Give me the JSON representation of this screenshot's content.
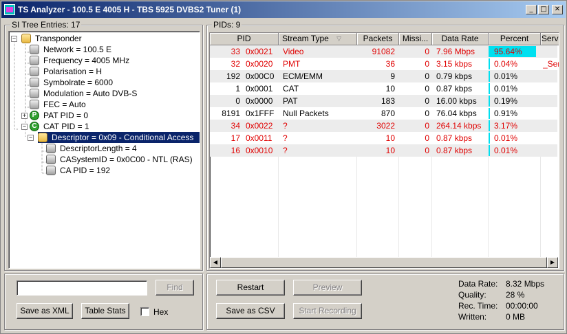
{
  "window": {
    "title": "TS Analyzer - 100.5 E 4005 H - TBS 5925 DVBS2 Tuner (1)"
  },
  "left_panel": {
    "label": "SI Tree Entries: 17",
    "tree": [
      {
        "text": "Transponder",
        "icon": "folder-icon",
        "expander": "−"
      },
      {
        "text": "Network = 100.5 E",
        "icon": "gray-node-icon"
      },
      {
        "text": "Frequency = 4005 MHz",
        "icon": "gray-node-icon"
      },
      {
        "text": "Polarisation = H",
        "icon": "gray-node-icon"
      },
      {
        "text": "Symbolrate = 6000",
        "icon": "gray-node-icon"
      },
      {
        "text": "Modulation = Auto DVB-S",
        "icon": "gray-node-icon"
      },
      {
        "text": "FEC = Auto",
        "icon": "gray-node-icon"
      },
      {
        "text": "PAT PID = 0",
        "icon": "pat-icon",
        "badge": "P",
        "expander": "+"
      },
      {
        "text": "CAT PID = 1",
        "icon": "cat-icon",
        "badge": "C",
        "expander": "−"
      },
      {
        "text": "Descriptor = 0x09 - Conditional Access",
        "icon": "folder-icon",
        "expander": "−",
        "selected": true
      },
      {
        "text": "DescriptorLength = 4",
        "icon": "gray-node-icon"
      },
      {
        "text": "CASystemID = 0x0C00 - NTL (RAS)",
        "icon": "gray-node-icon"
      },
      {
        "text": "CA PID = 192",
        "icon": "gray-node-icon"
      }
    ],
    "search_value": "",
    "find_label": "Find",
    "save_xml_label": "Save as XML",
    "table_stats_label": "Table Stats",
    "hex_label": "Hex"
  },
  "right_panel": {
    "label": "PIDs: 9",
    "columns": [
      "PID",
      "Stream Type",
      "Packets",
      "Missi...",
      "Data Rate",
      "Percent",
      "Servi"
    ],
    "rows": [
      {
        "pid": "33",
        "hex": "0x0021",
        "type": "Video",
        "packets": "91082",
        "missing": "0",
        "rate": "7.96 Mbps",
        "percent": "95.64%",
        "pct": 0.9564,
        "service": "",
        "red": true
      },
      {
        "pid": "32",
        "hex": "0x0020",
        "type": "PMT",
        "packets": "36",
        "missing": "0",
        "rate": "3.15 kbps",
        "percent": "0.04%",
        "pct": 0.0004,
        "service": "_Serv",
        "red": true
      },
      {
        "pid": "192",
        "hex": "0x00C0",
        "type": "ECM/EMM",
        "packets": "9",
        "missing": "0",
        "rate": "0.79 kbps",
        "percent": "0.01%",
        "pct": 0.0001,
        "service": "",
        "red": false
      },
      {
        "pid": "1",
        "hex": "0x0001",
        "type": "CAT",
        "packets": "10",
        "missing": "0",
        "rate": "0.87 kbps",
        "percent": "0.01%",
        "pct": 0.0001,
        "service": "",
        "red": false
      },
      {
        "pid": "0",
        "hex": "0x0000",
        "type": "PAT",
        "packets": "183",
        "missing": "0",
        "rate": "16.00 kbps",
        "percent": "0.19%",
        "pct": 0.0019,
        "service": "",
        "red": false
      },
      {
        "pid": "8191",
        "hex": "0x1FFF",
        "type": "Null Packets",
        "packets": "870",
        "missing": "0",
        "rate": "76.04 kbps",
        "percent": "0.91%",
        "pct": 0.0091,
        "service": "",
        "red": false
      },
      {
        "pid": "34",
        "hex": "0x0022",
        "type": "?",
        "packets": "3022",
        "missing": "0",
        "rate": "264.14 kbps",
        "percent": "3.17%",
        "pct": 0.0317,
        "service": "",
        "red": true
      },
      {
        "pid": "17",
        "hex": "0x0011",
        "type": "?",
        "packets": "10",
        "missing": "0",
        "rate": "0.87 kbps",
        "percent": "0.01%",
        "pct": 0.0001,
        "service": "",
        "red": true
      },
      {
        "pid": "16",
        "hex": "0x0010",
        "type": "?",
        "packets": "10",
        "missing": "0",
        "rate": "0.87 kbps",
        "percent": "0.01%",
        "pct": 0.0001,
        "service": "",
        "red": true
      }
    ],
    "restart_label": "Restart",
    "preview_label": "Preview",
    "save_csv_label": "Save as CSV",
    "start_recording_label": "Start Recording",
    "stats": [
      {
        "label": "Data Rate:",
        "value": "8.32 Mbps"
      },
      {
        "label": "Quality:",
        "value": "28 %"
      },
      {
        "label": "Rec. Time:",
        "value": "00:00:00"
      },
      {
        "label": "Written:",
        "value": "0 MB"
      }
    ]
  },
  "colors": {
    "accent_red": "#e00000",
    "percent_bar": "#00e0f0",
    "selection": "#0a246a"
  }
}
